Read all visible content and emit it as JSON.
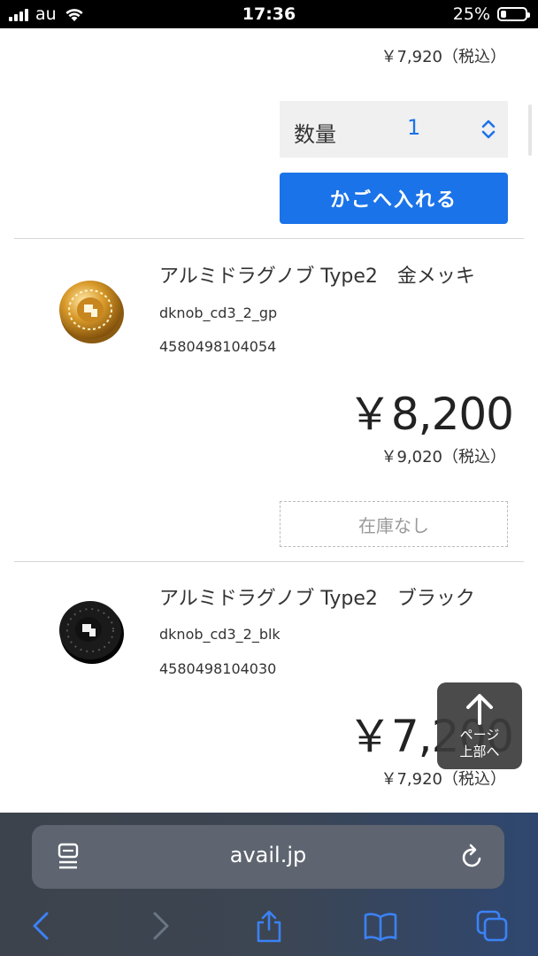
{
  "status_bar": {
    "carrier": "au",
    "time": "17:36",
    "battery": "25%"
  },
  "top_item": {
    "price_with_tax": "￥7,920（税込）",
    "quantity_label": "数量",
    "quantity_value": "1",
    "add_to_cart_label": "かごへ入れる"
  },
  "products": [
    {
      "name": "アルミドラグノブ Type2　金メッキ",
      "code": "dknob_cd3_2_gp",
      "jan": "4580498104054",
      "price": "￥8,200",
      "price_with_tax": "￥9,020（税込）",
      "stock_label": "在庫なし",
      "image_icon": "gold-drag-knob-image"
    },
    {
      "name": "アルミドラグノブ Type2　ブラック",
      "code": "dknob_cd3_2_blk",
      "jan": "4580498104030",
      "price": "￥7,200",
      "price_with_tax": "￥7,920（税込）",
      "image_icon": "black-drag-knob-image"
    }
  ],
  "page_top_button": {
    "line1": "ページ",
    "line2": "上部へ"
  },
  "browser": {
    "url": "avail.jp"
  },
  "colors": {
    "accent": "#1a73e8",
    "toolbar_icon": "#3b82f6"
  }
}
